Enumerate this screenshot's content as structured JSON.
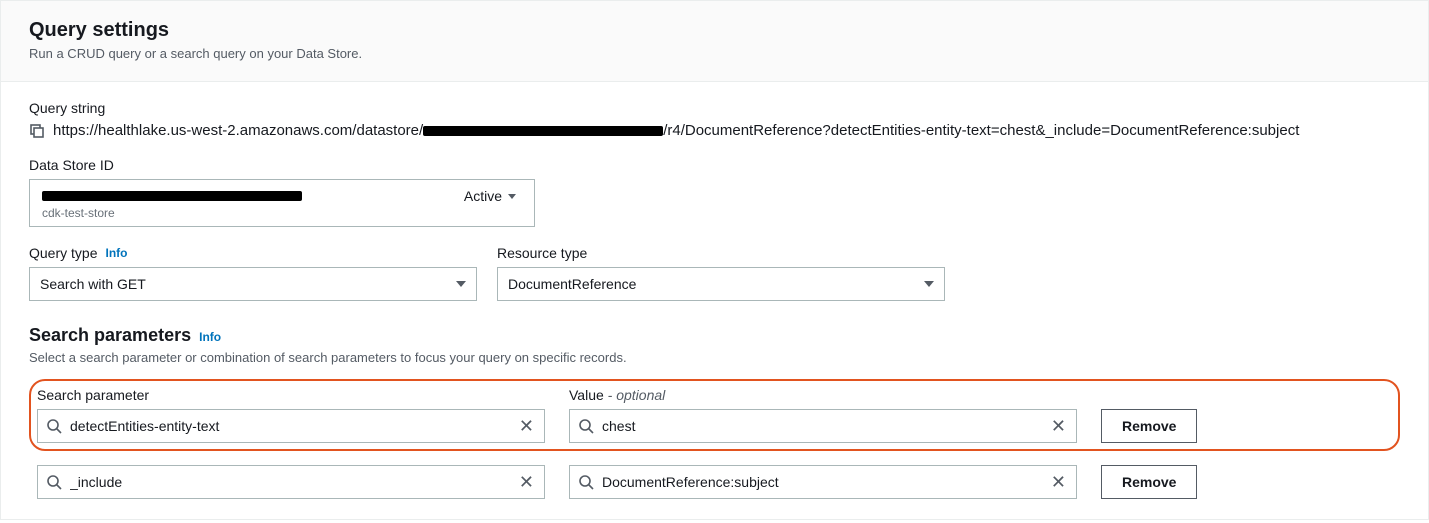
{
  "header": {
    "title": "Query settings",
    "subtitle": "Run a CRUD query or a search query on your Data Store."
  },
  "query_string": {
    "label": "Query string",
    "url_prefix": "https://healthlake.us-west-2.amazonaws.com/datastore/",
    "url_suffix": "/r4/DocumentReference?detectEntities-entity-text=chest&_include=DocumentReference:subject"
  },
  "data_store": {
    "label": "Data Store ID",
    "status": "Active",
    "alias": "cdk-test-store"
  },
  "query_type": {
    "label": "Query type",
    "info": "Info",
    "value": "Search with GET"
  },
  "resource_type": {
    "label": "Resource type",
    "value": "DocumentReference"
  },
  "search_params": {
    "title": "Search parameters",
    "info": "Info",
    "desc": "Select a search parameter or combination of search parameters to focus your query on specific records.",
    "param_label": "Search parameter",
    "value_label": "Value",
    "value_optional": "- optional",
    "remove_label": "Remove",
    "rows": [
      {
        "param": "detectEntities-entity-text",
        "value": "chest",
        "highlight": true
      },
      {
        "param": "_include",
        "value": "DocumentReference:subject",
        "highlight": false
      }
    ]
  }
}
